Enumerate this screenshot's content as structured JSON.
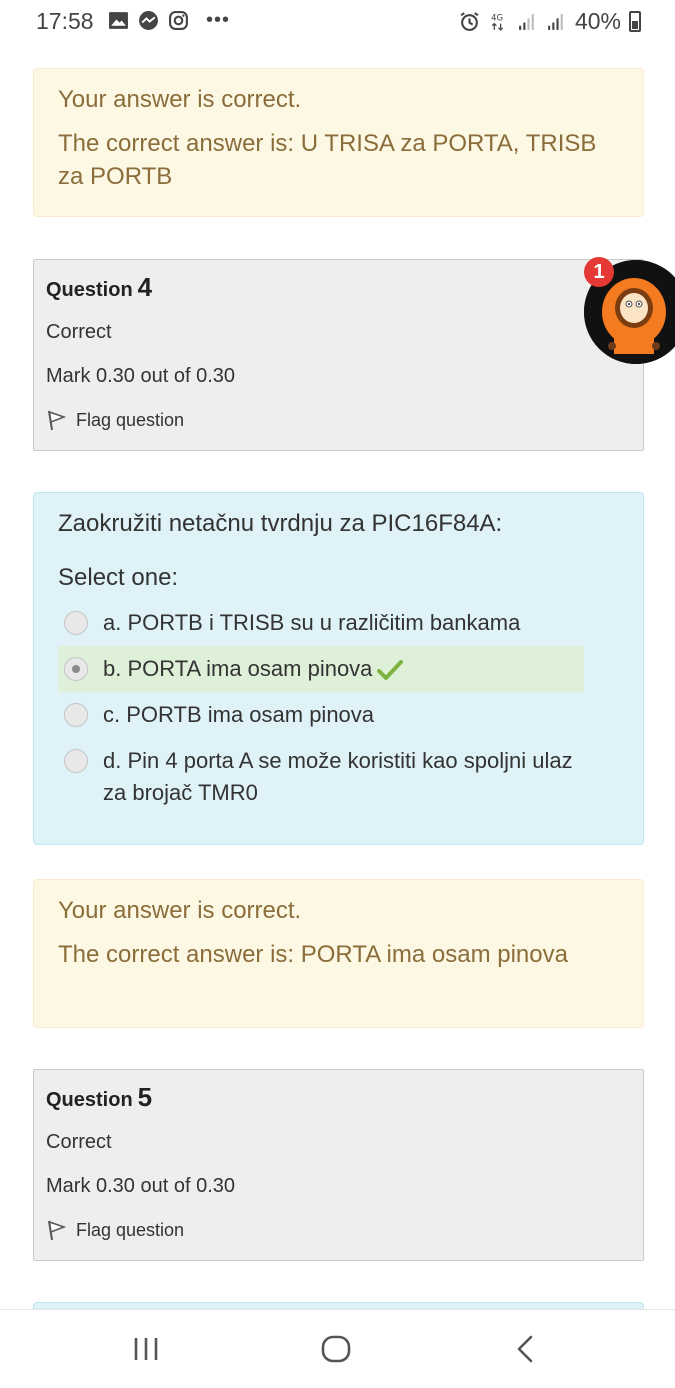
{
  "status_bar": {
    "time": "17:58",
    "battery": "40%",
    "overflow": "•••",
    "icons": [
      "gallery-icon",
      "messenger-icon",
      "instagram-icon",
      "alarm-icon",
      "4g-icon",
      "signal-icon",
      "signal-icon-2",
      "battery-icon"
    ]
  },
  "feedback_1": {
    "status": "Your answer is correct.",
    "right_answer": "The correct answer is: U TRISA za PORTA, TRISB za PORTB"
  },
  "question_4": {
    "label": "Question",
    "number": "4",
    "state": "Correct",
    "mark": "Mark 0.30 out of 0.30",
    "flag_label": "Flag question"
  },
  "question_content": {
    "text": "Zaokružiti netačnu tvrdnju za PIC16F84A:",
    "prompt": "Select one:",
    "answers": [
      {
        "label": "a. PORTB i TRISB su u različitim bankama",
        "selected": false
      },
      {
        "label": "b. PORTA ima osam pinova",
        "selected": true
      },
      {
        "label": "c. PORTB ima osam pinova",
        "selected": false
      },
      {
        "label": "d. Pin 4 porta A se može koristiti kao spoljni ulaz za brojač TMR0",
        "selected": false
      }
    ]
  },
  "feedback_2": {
    "status": "Your answer is correct.",
    "right_answer": "The correct answer is: PORTA ima osam pinova"
  },
  "question_5": {
    "label": "Question",
    "number": "5",
    "state": "Correct",
    "mark": "Mark 0.30 out of 0.30",
    "flag_label": "Flag question"
  },
  "chat_bubble": {
    "badge_count": "1"
  },
  "colors": {
    "feedback_bg": "#fcf8e3",
    "feedback_text": "#8a6d3b",
    "info_bg": "#eeeeee",
    "content_bg": "#def2f8",
    "correct_bg": "#dff0d8",
    "check_green": "#7cb342",
    "badge_red": "#e53935"
  }
}
